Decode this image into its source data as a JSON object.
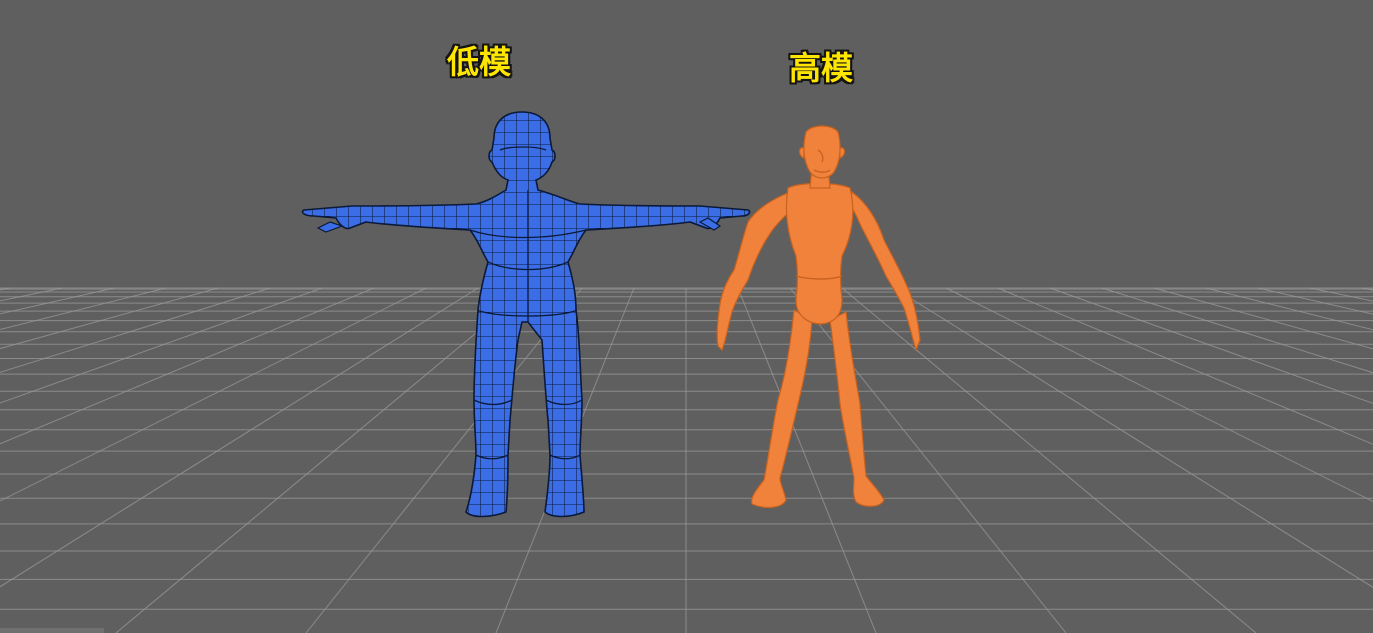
{
  "viewport": {
    "background_color": "#5f5f5f",
    "grid_color": "#9a9a9a"
  },
  "models": {
    "low_poly": {
      "label": "低模",
      "color": "#3b6ee6",
      "wire_color": "#0b1a3a",
      "style": "wireframe-on-shaded",
      "pose": "T-pose"
    },
    "high_poly": {
      "label": "高模",
      "color": "#f0823c",
      "style": "smooth-shaded",
      "pose": "A-pose"
    }
  }
}
